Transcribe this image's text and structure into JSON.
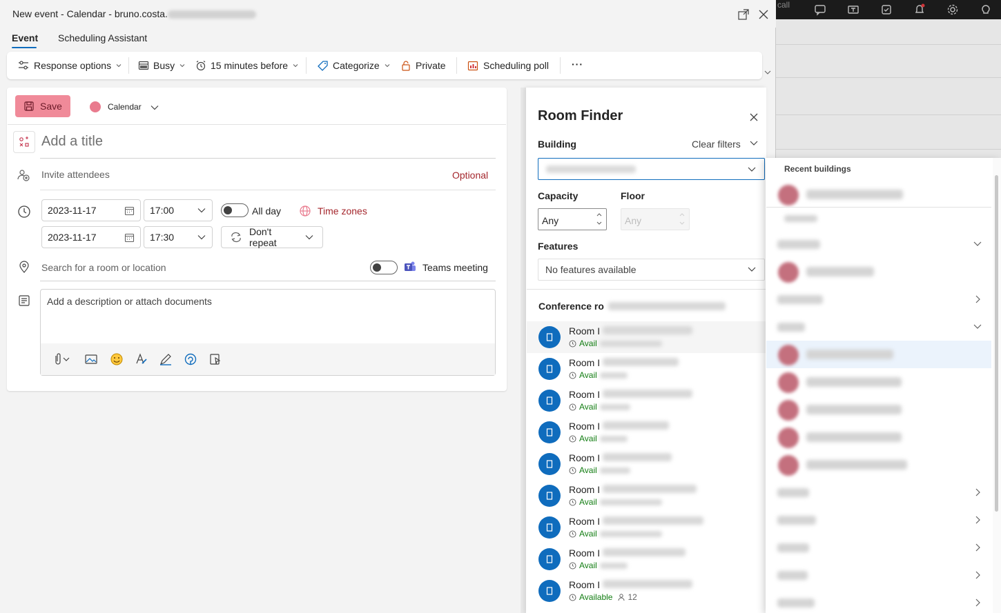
{
  "window": {
    "title_prefix": "New event - Calendar - bruno.costa.",
    "popout_icon": "popout-icon",
    "close_icon": "close-icon"
  },
  "tabs": [
    {
      "label": "Event",
      "active": true
    },
    {
      "label": "Scheduling Assistant",
      "active": false
    }
  ],
  "ribbon": {
    "response_options": "Response options",
    "busy": "Busy",
    "reminder": "15 minutes before",
    "categorize": "Categorize",
    "private": "Private",
    "scheduling_poll": "Scheduling poll",
    "more": "···"
  },
  "form": {
    "save_label": "Save",
    "calendar_label": "Calendar",
    "calendar_color": "#e97b8e",
    "title_placeholder": "Add a title",
    "attendees_placeholder": "Invite attendees",
    "optional_label": "Optional",
    "start_date": "2023-11-17",
    "start_time": "17:00",
    "end_date": "2023-11-17",
    "end_time": "17:30",
    "all_day_label": "All day",
    "time_zones_label": "Time zones",
    "repeat_label": "Don't repeat",
    "location_placeholder": "Search for a room or location",
    "teams_meeting_label": "Teams meeting",
    "description_placeholder": "Add a description or attach documents"
  },
  "room_finder": {
    "title": "Room Finder",
    "building_label": "Building",
    "clear_filters": "Clear filters",
    "capacity_label": "Capacity",
    "capacity_value": "Any",
    "floor_label": "Floor",
    "floor_value": "Any",
    "features_label": "Features",
    "features_value": "No features available",
    "conference_heading": "Conference ro",
    "rooms": [
      {
        "name": "Room I",
        "status": "Avail"
      },
      {
        "name": "Room I",
        "status": "Avail"
      },
      {
        "name": "Room I",
        "status": "Avail"
      },
      {
        "name": "Room I",
        "status": "Avail"
      },
      {
        "name": "Room I",
        "status": "Avail"
      },
      {
        "name": "Room I",
        "status": "Avail"
      },
      {
        "name": "Room I",
        "status": "Avail"
      },
      {
        "name": "Room I",
        "status": "Avail"
      },
      {
        "name": "Room I",
        "status": "Available",
        "capacity": "12"
      }
    ]
  },
  "recent_buildings": {
    "heading": "Recent buildings"
  },
  "colors": {
    "accent": "#0f6cbd",
    "save_bg": "#f08a99",
    "time_zones": "#a4262c",
    "available": "#107c10"
  }
}
